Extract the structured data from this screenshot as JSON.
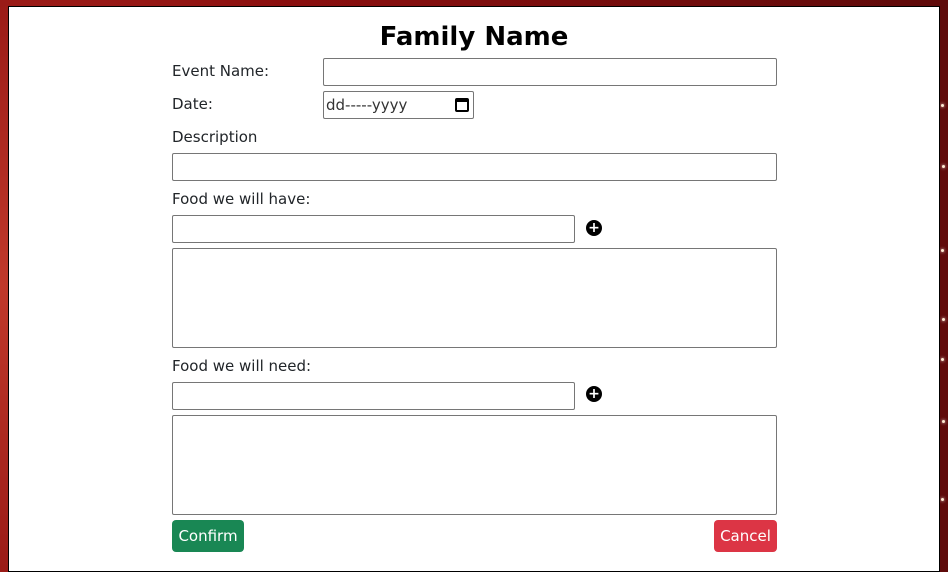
{
  "form": {
    "title": "Family Name",
    "event_name_label": "Event Name:",
    "event_name_value": "",
    "date_label": "Date:",
    "date_placeholder": "dd-----yyyy",
    "description_label": "Description",
    "description_value": "",
    "food_have_label": "Food we will have:",
    "food_have_input_value": "",
    "food_have_list": "",
    "food_need_label": "Food we will need:",
    "food_need_input_value": "",
    "food_need_list": "",
    "add_symbol": "+",
    "confirm_label": "Confirm",
    "cancel_label": "Cancel"
  },
  "colors": {
    "confirm": "#198754",
    "cancel": "#dc3545",
    "background": "#8b0f0f"
  },
  "icons": {
    "add": "plus-circle-icon",
    "calendar": "calendar-icon"
  }
}
